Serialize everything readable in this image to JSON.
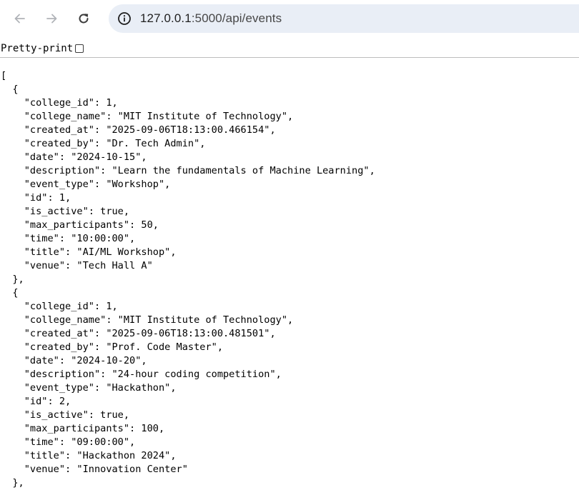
{
  "browser": {
    "url_host": "127.0.0.1",
    "url_path": ":5000/api/events",
    "icons": {
      "back": "back-arrow-icon",
      "forward": "forward-arrow-icon",
      "reload": "reload-icon",
      "site_info": "info-icon"
    }
  },
  "toolbar": {
    "pretty_print_label": "Pretty-print"
  },
  "json_lines": [
    "[",
    "  {",
    "    \"college_id\": 1,",
    "    \"college_name\": \"MIT Institute of Technology\",",
    "    \"created_at\": \"2025-09-06T18:13:00.466154\",",
    "    \"created_by\": \"Dr. Tech Admin\",",
    "    \"date\": \"2024-10-15\",",
    "    \"description\": \"Learn the fundamentals of Machine Learning\",",
    "    \"event_type\": \"Workshop\",",
    "    \"id\": 1,",
    "    \"is_active\": true,",
    "    \"max_participants\": 50,",
    "    \"time\": \"10:00:00\",",
    "    \"title\": \"AI/ML Workshop\",",
    "    \"venue\": \"Tech Hall A\"",
    "  },",
    "  {",
    "    \"college_id\": 1,",
    "    \"college_name\": \"MIT Institute of Technology\",",
    "    \"created_at\": \"2025-09-06T18:13:00.481501\",",
    "    \"created_by\": \"Prof. Code Master\",",
    "    \"date\": \"2024-10-20\",",
    "    \"description\": \"24-hour coding competition\",",
    "    \"event_type\": \"Hackathon\",",
    "    \"id\": 2,",
    "    \"is_active\": true,",
    "    \"max_participants\": 100,",
    "    \"time\": \"09:00:00\",",
    "    \"title\": \"Hackathon 2024\",",
    "    \"venue\": \"Innovation Center\"",
    "  },"
  ]
}
